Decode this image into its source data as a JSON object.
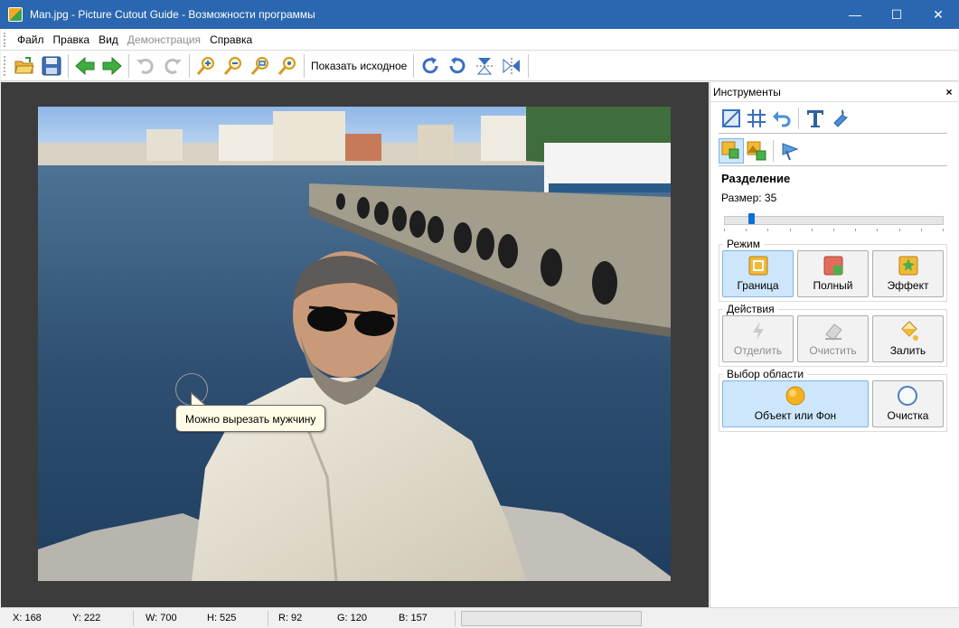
{
  "window": {
    "title": "Man.jpg - Picture Cutout Guide - Возможности программы",
    "icons": {
      "app": "app-icon",
      "minimize": "minimize-icon",
      "maximize": "maximize-icon",
      "close": "close-icon"
    }
  },
  "menu": {
    "items": [
      {
        "label": "Файл",
        "enabled": true
      },
      {
        "label": "Правка",
        "enabled": true
      },
      {
        "label": "Вид",
        "enabled": true
      },
      {
        "label": "Демонстрация",
        "enabled": false
      },
      {
        "label": "Справка",
        "enabled": true
      }
    ]
  },
  "toolbar": {
    "show_original_label": "Показать исходное",
    "icons": [
      "open-folder-icon",
      "save-icon",
      "back-arrow-icon",
      "forward-arrow-icon",
      "undo-icon",
      "redo-icon",
      "zoom-in-icon",
      "zoom-out-icon",
      "zoom-fit-icon",
      "zoom-actual-icon",
      "rotate-right-icon",
      "rotate-left-icon",
      "flip-vertical-icon",
      "flip-horizontal-icon"
    ]
  },
  "canvas": {
    "tooltip": "Можно вырезать мужчину",
    "image": "photo-man-by-sea"
  },
  "panel": {
    "title": "Инструменты",
    "close_label": "×",
    "tool_icons": [
      "crop-icon",
      "grid-icon",
      "undo-arrow-icon",
      "text-icon",
      "wrench-icon"
    ],
    "mode_icons": [
      "cutout-tool-icon",
      "cutout-alt-icon",
      "wizard-icon"
    ],
    "section_title": "Разделение",
    "size_label": "Размер: 35",
    "size_value": 35,
    "size_min": 1,
    "size_max": 300,
    "groups": {
      "mode": {
        "title": "Режим",
        "buttons": [
          {
            "label": "Граница",
            "icon": "border-icon",
            "selected": true
          },
          {
            "label": "Полный",
            "icon": "full-icon",
            "selected": false
          },
          {
            "label": "Эффект",
            "icon": "effect-icon",
            "selected": false
          }
        ]
      },
      "actions": {
        "title": "Действия",
        "buttons": [
          {
            "label": "Отделить",
            "icon": "separate-icon",
            "enabled": false
          },
          {
            "label": "Очистить",
            "icon": "eraser-icon",
            "enabled": false
          },
          {
            "label": "Залить",
            "icon": "fill-icon",
            "enabled": true
          }
        ]
      },
      "selection": {
        "title": "Выбор области",
        "buttons": [
          {
            "label": "Объект или Фон",
            "icon": "object-or-background-icon",
            "selected": true
          },
          {
            "label": "Очистка",
            "icon": "clear-circle-icon",
            "selected": false
          }
        ]
      }
    }
  },
  "status": {
    "x": "X: 168",
    "y": "Y: 222",
    "w": "W: 700",
    "h": "H: 525",
    "r": "R: 92",
    "g": "G: 120",
    "b": "B: 157"
  },
  "colors": {
    "titlebar": "#2b67b0",
    "selected_button": "#cde6fb",
    "canvas_bg": "#3c3c3c",
    "tooltip_bg": "#fffbe6"
  }
}
